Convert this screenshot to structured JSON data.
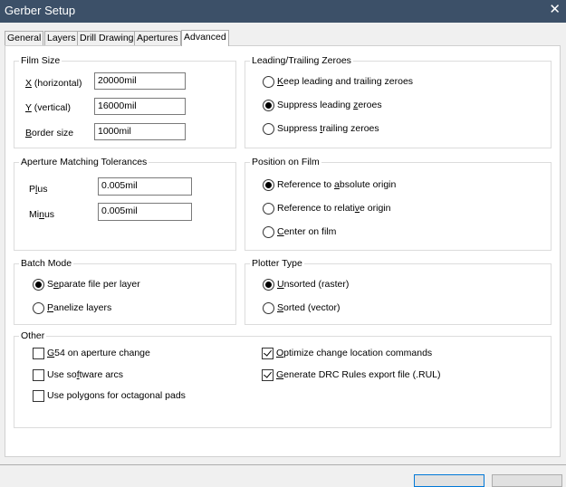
{
  "window": {
    "title": "Gerber Setup",
    "close_glyph": "✕"
  },
  "tabs": [
    {
      "label": "General",
      "active": false
    },
    {
      "label": "Layers",
      "active": false
    },
    {
      "label": "Drill Drawing",
      "active": false
    },
    {
      "label": "Apertures",
      "active": false
    },
    {
      "label": "Advanced",
      "active": true
    }
  ],
  "film_size": {
    "title": "Film Size",
    "horizontal": {
      "accel": "X",
      "rest": " (horizontal)",
      "value": "20000mil"
    },
    "vertical": {
      "accel": "Y",
      "rest": " (vertical)",
      "value": "16000mil"
    },
    "border": {
      "accel": "B",
      "rest": "order size",
      "value": "1000mil"
    }
  },
  "aperture_tolerances": {
    "title": "Aperture Matching Tolerances",
    "plus": {
      "pre": "P",
      "accel": "l",
      "post": "us",
      "value": "0.005mil"
    },
    "minus": {
      "pre": "Mi",
      "accel": "n",
      "post": "us",
      "value": "0.005mil"
    }
  },
  "batch_mode": {
    "title": "Batch Mode",
    "separate": {
      "pre": "S",
      "accel": "e",
      "post": "parate file per layer",
      "selected": true
    },
    "panelize": {
      "pre": "",
      "accel": "P",
      "post": "anelize layers",
      "selected": false
    }
  },
  "zeroes": {
    "title": "Leading/Trailing Zeroes",
    "keep": {
      "pre": "",
      "accel": "K",
      "post": "eep leading and trailing zeroes",
      "selected": false
    },
    "suppress_leading": {
      "pre": "Suppress leading ",
      "accel": "z",
      "post": "eroes",
      "selected": true
    },
    "suppress_trailing": {
      "pre": "Suppress ",
      "accel": "t",
      "post": "railing zeroes",
      "selected": false
    }
  },
  "position": {
    "title": "Position on Film",
    "absolute": {
      "pre": "Reference to ",
      "accel": "a",
      "post": "bsolute origin",
      "selected": true
    },
    "relative": {
      "pre": "Reference to relati",
      "accel": "v",
      "post": "e origin",
      "selected": false
    },
    "center": {
      "pre": "",
      "accel": "C",
      "post": "enter on film",
      "selected": false
    }
  },
  "plotter": {
    "title": "Plotter Type",
    "unsorted": {
      "pre": "",
      "accel": "U",
      "post": "nsorted (raster)",
      "selected": true
    },
    "sorted": {
      "pre": "",
      "accel": "S",
      "post": "orted (vector)",
      "selected": false
    }
  },
  "other": {
    "title": "Other",
    "g54": {
      "pre": "",
      "accel": "G",
      "post": "54 on aperture change",
      "checked": false
    },
    "software_arcs": {
      "pre": "Use so",
      "accel": "f",
      "post": "tware arcs",
      "checked": false
    },
    "polygons": {
      "pre": "Use polygons for octagonal pads",
      "accel": "",
      "post": "",
      "checked": false
    },
    "optimize": {
      "pre": "",
      "accel": "O",
      "post": "ptimize change location commands",
      "checked": true
    },
    "drc": {
      "pre": "",
      "accel": "G",
      "post": "enerate DRC Rules export file (.RUL)",
      "checked": true
    }
  }
}
